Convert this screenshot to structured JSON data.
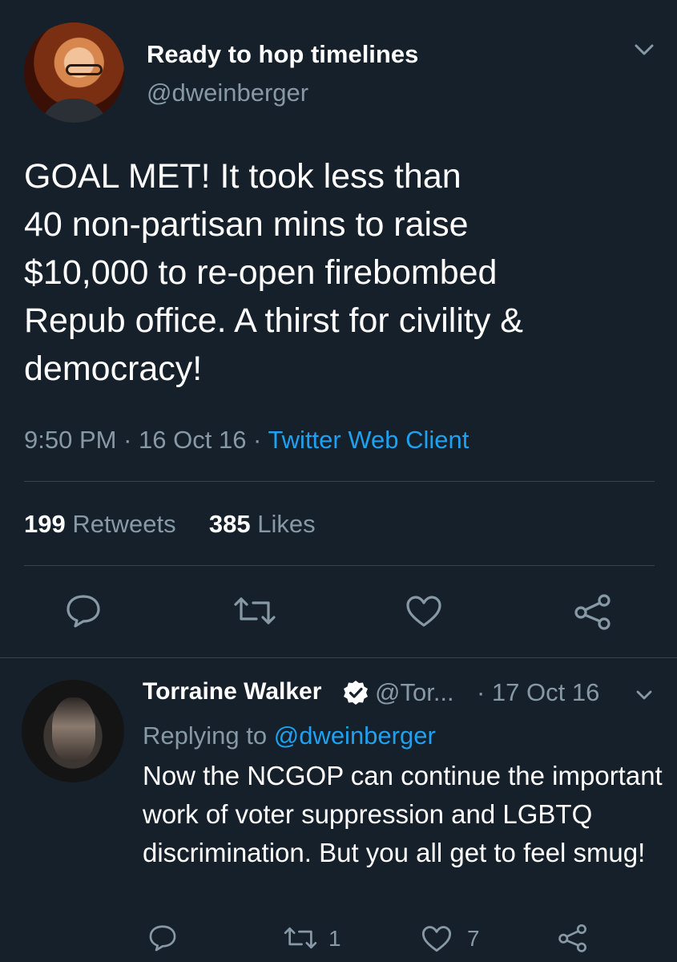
{
  "main_tweet": {
    "display_name": "Ready to hop timelines",
    "handle": "@dweinberger",
    "text": "GOAL MET! It took less than\n40 non-partisan mins to raise\n$10,000 to re-open firebombed\nRepub office. A thirst for civility &\ndemocracy!",
    "time": "9:50 PM",
    "sep1": " · ",
    "date": "16 Oct 16",
    "sep2": " · ",
    "client": "Twitter Web Client",
    "retweets_count": "199",
    "retweets_label": "Retweets",
    "likes_count": "385",
    "likes_label": "Likes"
  },
  "reply": {
    "display_name": "Torraine Walker",
    "handle": "@Tor...",
    "date": "· 17 Oct 16",
    "replying_prefix": "Replying to ",
    "replying_to": "@dweinberger",
    "text": "Now the NCGOP can continue the important work of voter suppression and LGBTQ discrimination. But you all get to feel smug!",
    "retweet_count": "1",
    "like_count": "7"
  },
  "icons": {
    "reply": "reply-icon",
    "retweet": "retweet-icon",
    "like": "heart-icon",
    "share": "share-icon",
    "menu": "chevron-down-icon",
    "verified": "verified-badge-icon"
  },
  "colors": {
    "background": "#15202b",
    "text": "#ffffff",
    "muted": "#8899a6",
    "link": "#1da1f2",
    "divider": "#38444d"
  }
}
